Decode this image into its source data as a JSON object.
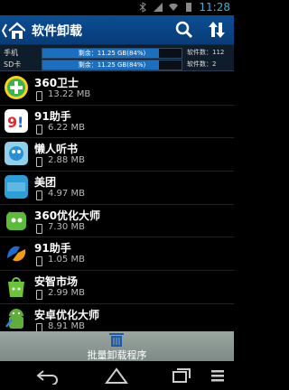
{
  "status": {
    "time": "11:28"
  },
  "header": {
    "title": "软件卸载"
  },
  "storage": {
    "rows": [
      {
        "label": "手机",
        "bar_text": "剩余：11.25 GB(84%)",
        "used_fraction": 0.84,
        "count": "软件数：112"
      },
      {
        "label": "SD卡",
        "bar_text": "剩余：11.25 GB(84%)",
        "used_fraction": 0.84,
        "count": "软件数：2"
      }
    ]
  },
  "apps": [
    {
      "name": "360卫士",
      "size": "13.22 MB",
      "icon": "360-guard-icon",
      "color": "#3cb44b"
    },
    {
      "name": "91助手",
      "size": "6.22 MB",
      "icon": "91-assistant-icon",
      "color": "#e8262b"
    },
    {
      "name": "懒人听书",
      "size": "2.88 MB",
      "icon": "lazy-audiobook-icon",
      "color": "#2b8fd6"
    },
    {
      "name": "美团",
      "size": "4.97 MB",
      "icon": "meituan-icon",
      "color": "#2a9fd8"
    },
    {
      "name": "360优化大师",
      "size": "7.30 MB",
      "icon": "360-optimizer-icon",
      "color": "#5dbb3a"
    },
    {
      "name": "91助手",
      "size": "1.05 MB",
      "icon": "91-assistant-icon",
      "color": "#1e6ad1"
    },
    {
      "name": "安智市场",
      "size": "2.99 MB",
      "icon": "anzhi-market-icon",
      "color": "#6cc43a"
    },
    {
      "name": "安卓优化大师",
      "size": "8.91 MB",
      "icon": "android-optimizer-icon",
      "color": "#5fae3b"
    }
  ],
  "bottom": {
    "label": "批量卸载程序"
  }
}
